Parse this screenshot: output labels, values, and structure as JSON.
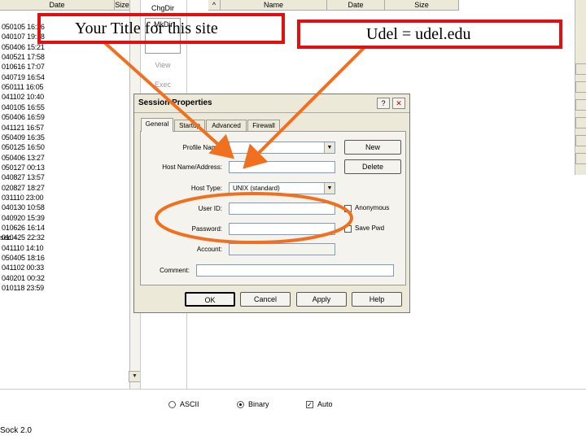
{
  "left_panel": {
    "col_date": "Date",
    "col_size": "Size",
    "rows": [
      "050105 16:26",
      "040107 19:18",
      "050406 15:21",
      "040521 17:58",
      "010616 17:07",
      "040719 16:54",
      "050111 16:05",
      "041102 10:40",
      "040105 16:55",
      "050406 16:59",
      "041121 16:57",
      "050409 16:35",
      "050125 16:50",
      "050406 13:27",
      "050127 00:13",
      "040827 13:57",
      "020827 18:27",
      "031110 23:00",
      "040130 10:58",
      "040920 15:39",
      "010626 16:14",
      "010425 22:32",
      "041110 14:10",
      "050405 18:16",
      "041102 00:33",
      "040201 00:32",
      "010118 23:59"
    ],
    "truncated_label": "sec.~"
  },
  "middle_buttons": [
    "ChgDir",
    "MkDir",
    "View",
    "Exec"
  ],
  "right_panel": {
    "col_name": "Name",
    "col_date": "Date",
    "col_size": "Size"
  },
  "dialog": {
    "title": "Session Properties",
    "help_btn": "?",
    "close_btn": "✕",
    "tabs": [
      "General",
      "Startup",
      "Advanced",
      "Firewall"
    ],
    "labels": {
      "profile": "Profile Name:",
      "host": "Host Name/Address:",
      "host_type": "Host Type:",
      "user": "User ID:",
      "password": "Password:",
      "account": "Account:",
      "comment": "Comment:"
    },
    "host_type_value": "UNIX (standard)",
    "buttons": {
      "new": "New",
      "delete": "Delete",
      "ok": "OK",
      "cancel": "Cancel",
      "apply": "Apply",
      "help": "Help"
    },
    "checks": {
      "anonymous": "Anonymous",
      "save_pwd": "Save Pwd"
    }
  },
  "bottom_bar": {
    "ascii": "ASCII",
    "binary": "Binary",
    "auto": "Auto",
    "status": "Sock 2.0"
  },
  "annotations": {
    "title_text": "Your Title for this site",
    "host_text": "Udel = udel.edu"
  },
  "colors": {
    "annotation_red": "#e01010",
    "annotation_orange": "#f07020"
  }
}
